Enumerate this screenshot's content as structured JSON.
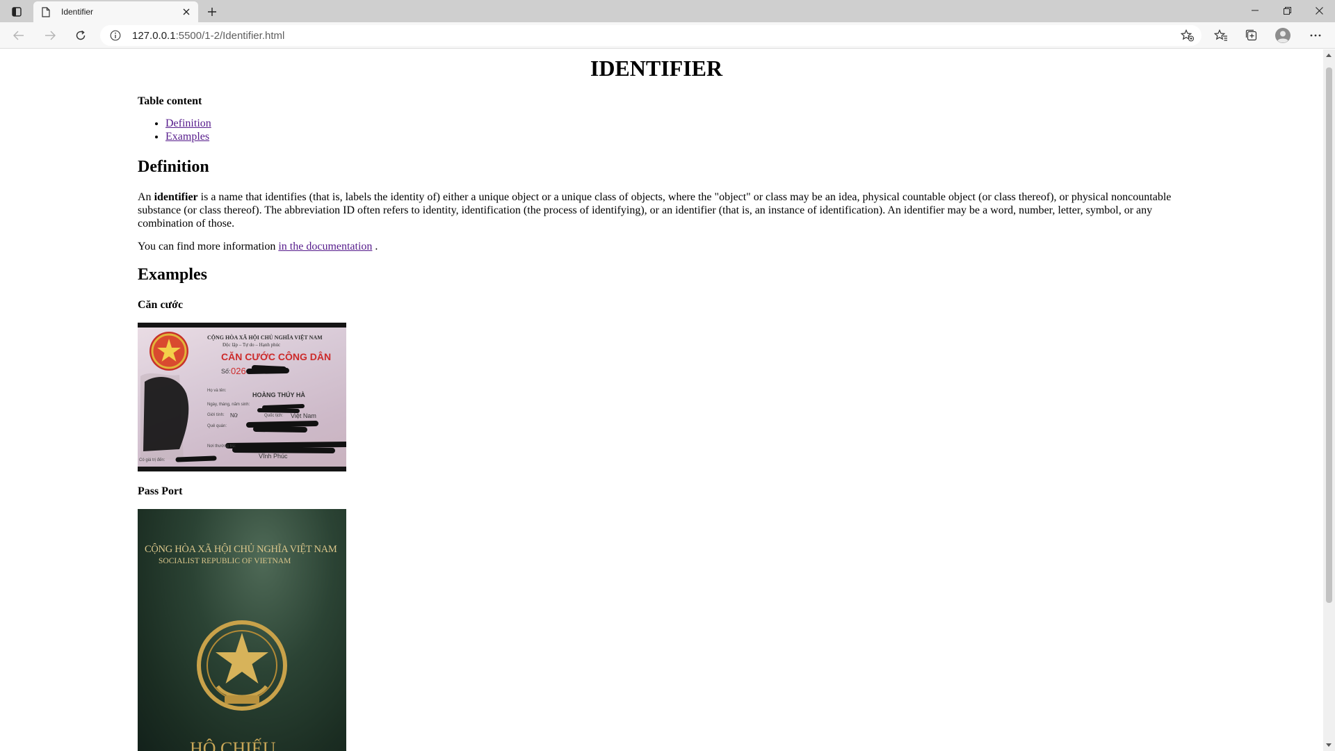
{
  "browser": {
    "tab_title": "Identifier",
    "url_host": "127.0.0.1",
    "url_path": ":5500/1-2/Identifier.html"
  },
  "page": {
    "title": "IDENTIFIER",
    "toc": {
      "heading": "Table content",
      "items": [
        "Definition",
        "Examples"
      ]
    },
    "definition": {
      "heading": "Definition",
      "text_prefix": "An ",
      "text_bold": "identifier",
      "text_rest": " is a name that identifies (that is, labels the identity of) either a unique object or a unique class of objects, where the \"object\" or class may be an idea, physical countable object (or class thereof), or physical noncountable substance (or class thereof). The abbreviation ID often refers to identity, identification (the process of identifying), or an identifier (that is, an instance of identification). An identifier may be a word, number, letter, symbol, or any combination of those.",
      "more_prefix": "You can find more information ",
      "more_link": "in the documentation",
      "more_suffix": " ."
    },
    "examples": {
      "heading": "Examples",
      "items": [
        {
          "label": "Căn cước",
          "image_text": {
            "country": "CỘNG HÒA XÃ HỘI CHỦ NGHĨA VIỆT NAM",
            "motto": "Độc lập – Tự do – Hạnh phúc",
            "card_title": "CĂN CƯỚC CÔNG DÂN",
            "number_label": "Số:",
            "number_value": "026",
            "name_label": "Họ và tên:",
            "name_value": "HOÀNG THÚY HÀ",
            "dob_label": "Ngày, tháng, năm sinh:",
            "sex_label": "Giới tính:",
            "sex_value": "Nữ",
            "nationality_label": "Quốc tịch:",
            "nationality_value": "Việt Nam",
            "hometown_label": "Quê quán:",
            "residence_label": "Nơi thường trú:",
            "residence_value": "Vĩnh Phúc",
            "expiry_label": "Có giá trị đến:"
          }
        },
        {
          "label": "Pass Port",
          "image_text": {
            "line1": "CỘNG HÒA XÃ HỘI CHỦ NGHĨA VIỆT NAM",
            "line2": "SOCIALIST REPUBLIC OF VIETNAM",
            "line3": "HỘ CHIẾU"
          }
        }
      ]
    }
  }
}
